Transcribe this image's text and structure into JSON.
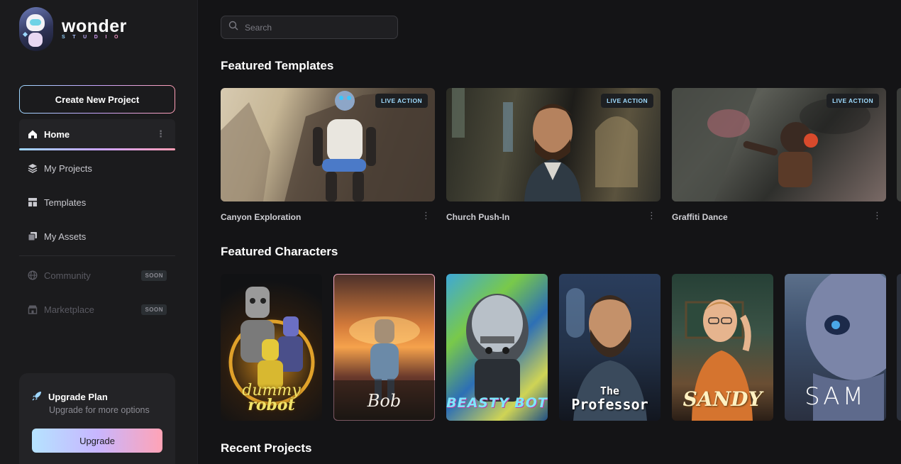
{
  "app": {
    "logo_word": "wonder",
    "logo_sub": "STUDIO"
  },
  "sidebar": {
    "create_label": "Create New Project",
    "items": [
      {
        "label": "Home",
        "icon": "home-icon",
        "active": true
      },
      {
        "label": "My Projects",
        "icon": "layers-icon"
      },
      {
        "label": "Templates",
        "icon": "templates-icon"
      },
      {
        "label": "My Assets",
        "icon": "assets-icon"
      },
      {
        "label": "Community",
        "icon": "globe-icon",
        "badge": "SOON",
        "disabled": true
      },
      {
        "label": "Marketplace",
        "icon": "store-icon",
        "badge": "SOON",
        "disabled": true
      }
    ],
    "upgrade": {
      "title": "Upgrade Plan",
      "subtitle": "Upgrade for more options",
      "button": "Upgrade"
    }
  },
  "search": {
    "placeholder": "Search"
  },
  "sections": {
    "featured_templates": "Featured Templates",
    "featured_characters": "Featured Characters",
    "recent_projects": "Recent Projects"
  },
  "templates": [
    {
      "name": "Canyon Exploration",
      "badge": "LIVE ACTION"
    },
    {
      "name": "Church Push-In",
      "badge": "LIVE ACTION"
    },
    {
      "name": "Graffiti Dance",
      "badge": "LIVE ACTION"
    }
  ],
  "characters": [
    {
      "label_line1": "dummy",
      "label_line2": "robot"
    },
    {
      "label_line1": "Bob"
    },
    {
      "label_line1": "BEASTY BOT"
    },
    {
      "label_line1": "The",
      "label_line2": "Professor"
    },
    {
      "label_line1": "SANDY"
    },
    {
      "label_line1": "SAM"
    }
  ]
}
